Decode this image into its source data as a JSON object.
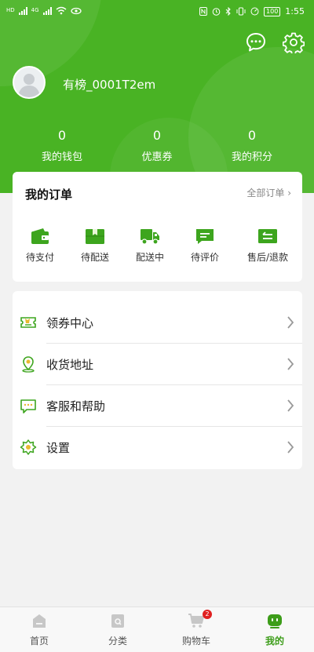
{
  "status_bar": {
    "time": "1:55",
    "battery": "100",
    "network_left_1": "HD",
    "network_left_2": "4G"
  },
  "header": {
    "username": "有榜_0001T2em",
    "stats": [
      {
        "value": "0",
        "label": "我的钱包"
      },
      {
        "value": "0",
        "label": "优惠券"
      },
      {
        "value": "0",
        "label": "我的积分"
      }
    ]
  },
  "orders": {
    "title": "我的订单",
    "all_label": "全部订单 ›",
    "items": [
      {
        "label": "待支付",
        "icon": "wallet-icon"
      },
      {
        "label": "待配送",
        "icon": "package-icon"
      },
      {
        "label": "配送中",
        "icon": "truck-icon"
      },
      {
        "label": "待评价",
        "icon": "comment-icon"
      },
      {
        "label": "售后/退款",
        "icon": "refund-icon"
      }
    ]
  },
  "menu": {
    "items": [
      {
        "label": "领券中心",
        "icon": "coupon-icon"
      },
      {
        "label": "收货地址",
        "icon": "location-icon"
      },
      {
        "label": "客服和帮助",
        "icon": "chat-help-icon"
      },
      {
        "label": "设置",
        "icon": "settings-flower-icon"
      }
    ]
  },
  "tabbar": {
    "items": [
      {
        "label": "首页",
        "icon": "home-icon"
      },
      {
        "label": "分类",
        "icon": "category-icon"
      },
      {
        "label": "购物车",
        "icon": "cart-icon",
        "badge": "2"
      },
      {
        "label": "我的",
        "icon": "profile-icon",
        "active": true
      }
    ]
  },
  "colors": {
    "brand_green": "#49b324",
    "icon_green": "#3da51e",
    "badge_red": "#e02020"
  }
}
